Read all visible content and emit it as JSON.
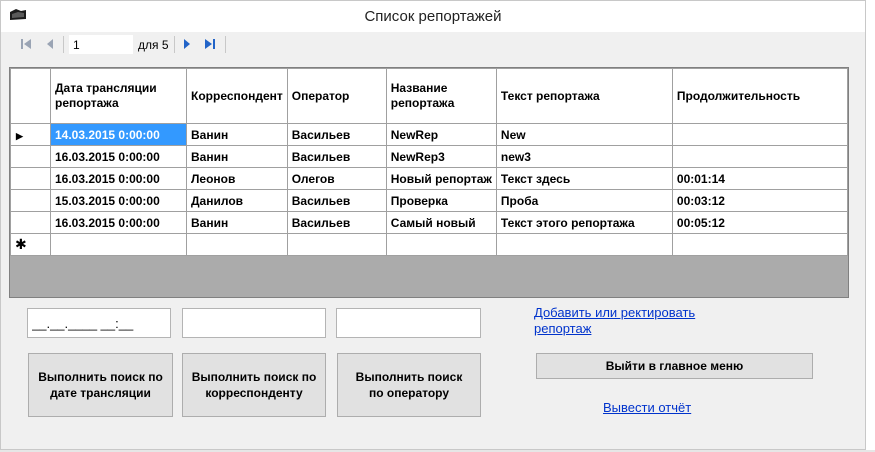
{
  "window": {
    "title": "Список репортажей"
  },
  "navigator": {
    "position": "1",
    "count_label": "для 5",
    "icons": [
      "first-record-icon",
      "previous-record-icon",
      "next-record-icon",
      "last-record-icon"
    ]
  },
  "grid": {
    "columns": [
      "Дата трансляции репортажа",
      "Корреспондент",
      "Оператор",
      "Название репортажа",
      "Текст репортажа",
      "Продолжительность"
    ],
    "rows": [
      {
        "date": "14.03.2015 0:00:00",
        "correspondent": "Ванин",
        "operator": "Васильев",
        "name": "NewRep",
        "text": "New",
        "duration": ""
      },
      {
        "date": "16.03.2015 0:00:00",
        "correspondent": "Ванин",
        "operator": "Васильев",
        "name": "NewRep3",
        "text": "new3",
        "duration": ""
      },
      {
        "date": "16.03.2015 0:00:00",
        "correspondent": "Леонов",
        "operator": "Олегов",
        "name": "Новый репортаж",
        "text": "Текст здесь",
        "duration": "00:01:14"
      },
      {
        "date": "15.03.2015 0:00:00",
        "correspondent": "Данилов",
        "operator": "Васильев",
        "name": "Проверка",
        "text": "Проба",
        "duration": "00:03:12"
      },
      {
        "date": "16.03.2015 0:00:00",
        "correspondent": "Ванин",
        "operator": "Васильев",
        "name": "Самый новый",
        "text": "Текст этого репортажа",
        "duration": "00:05:12"
      }
    ],
    "current_row_marker": "▶",
    "new_row_marker": "✱",
    "selection_color": "#3399ff"
  },
  "search": {
    "date_field_value": "__.__.____ __:__",
    "correspondent_field_value": "",
    "operator_field_value": "",
    "by_date_label": "Выполнить поиск по дате трансляции",
    "by_correspondent_label": "Выполнить поиск по корреспонденту",
    "by_operator_label": "Выполнить поиск по оператору"
  },
  "actions": {
    "add_edit_link": "Добавить или ректировать репортаж",
    "main_menu_button": "Выйти в главное меню",
    "report_link": "Вывести отчёт"
  },
  "colors": {
    "link": "#0033cc",
    "grid_background": "#ababab"
  }
}
